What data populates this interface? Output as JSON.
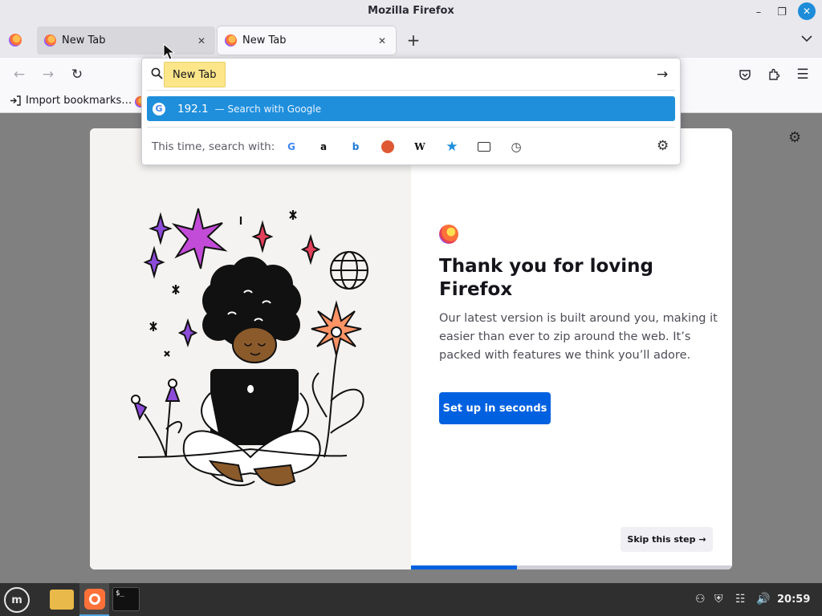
{
  "window": {
    "title": "Mozilla Firefox"
  },
  "tabs": [
    {
      "label": "New Tab",
      "active": false
    },
    {
      "label": "New Tab",
      "active": true
    }
  ],
  "toolbar": {
    "back": "back-arrow-icon",
    "forward": "forward-arrow-icon",
    "reload": "reload-icon",
    "right_icons": [
      "pocket-icon",
      "extensions-icon",
      "menu-icon"
    ]
  },
  "bookmarks": {
    "import_label": "Import bookmarks…"
  },
  "urlbar": {
    "tooltip": "New Tab",
    "value": "",
    "result": {
      "text": "192.1",
      "sub": "— Search with Google"
    },
    "oneoff_label": "This time, search with:",
    "engines": [
      "google-icon",
      "amazon-icon",
      "bing-icon",
      "duckduckgo-icon",
      "wikipedia-icon",
      "bookmarks-icon",
      "tabs-icon",
      "history-icon"
    ]
  },
  "onboarding": {
    "headline": "Thank you for loving Firefox",
    "body": "Our latest version is built around you, making it easier than ever to zip around the web. It’s packed with features we think you’ll adore.",
    "cta": "Set up in seconds",
    "skip": "Skip this step →",
    "progress": 0.33
  },
  "taskbar": {
    "clock": "20:59",
    "terminal_prompt": "$_"
  },
  "colors": {
    "accent": "#0061e0",
    "highlight": "#1f8fdc",
    "tooltip": "#fde68a"
  }
}
